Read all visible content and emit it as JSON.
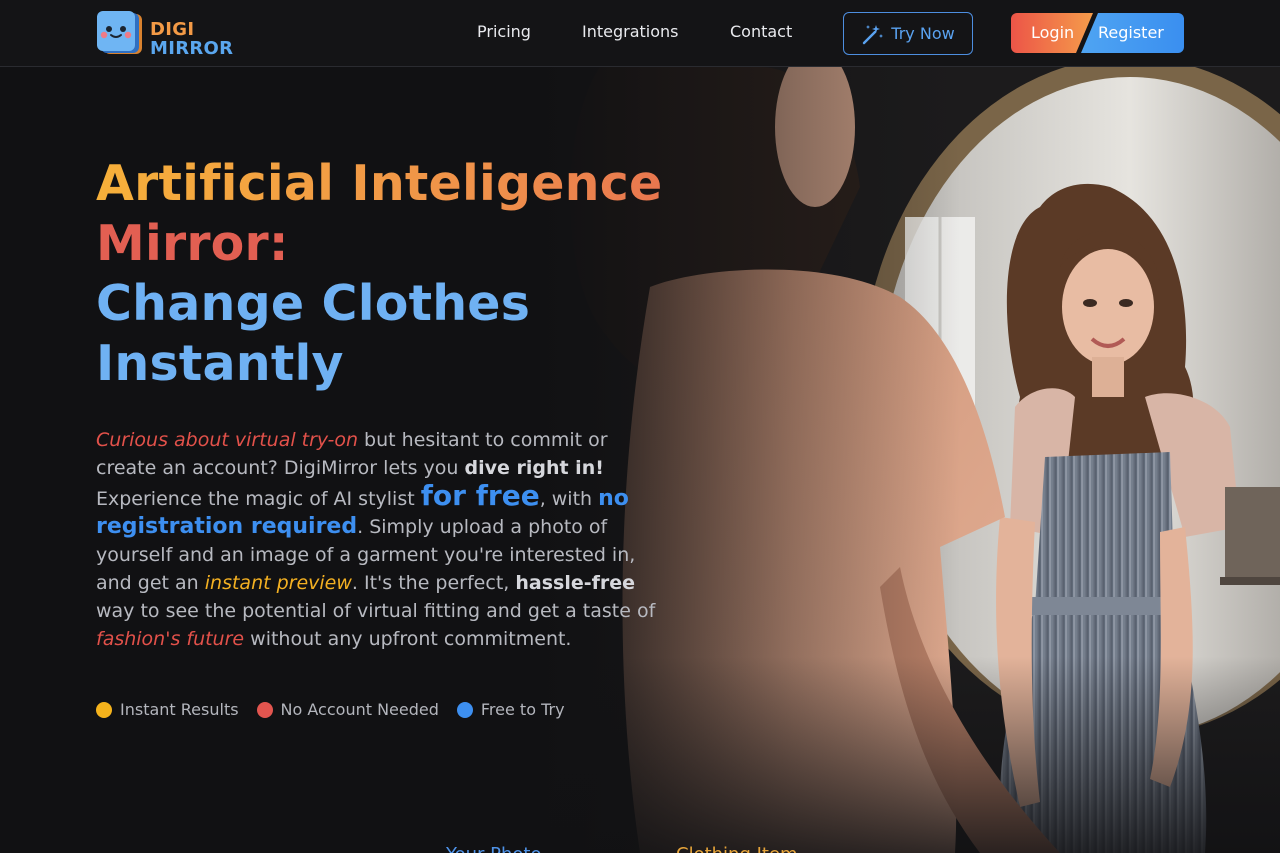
{
  "logo": {
    "line1": "DIGI",
    "line2": "MIRROR"
  },
  "nav": {
    "items": [
      {
        "label": "Pricing"
      },
      {
        "label": "Integrations"
      },
      {
        "label": "Contact"
      }
    ],
    "try_now": "Try Now",
    "login": "Login",
    "register": "Register"
  },
  "hero": {
    "title_line1": "Artificial Inteligence",
    "title_line2": "Mirror:",
    "title_line3": "Change Clothes",
    "title_line4": "Instantly",
    "description": {
      "s1": "Curious about virtual try-on",
      "s2": " but hesitant to commit or create an account? DigiMirror lets you ",
      "s3": "dive right in!",
      "s4": " Experience the magic of AI stylist ",
      "s5": "for free",
      "s6": ", with ",
      "s7": "no registration required",
      "s8": ". Simply upload a photo of yourself and an image of a garment you're interested in, and get an ",
      "s9": "instant preview",
      "s10": ". It's the perfect, ",
      "s11": "hassle-free",
      "s12": " way to see the potential of virtual fitting and get a taste of ",
      "s13": "fashion's future",
      "s14": " without any upfront commitment."
    },
    "features": [
      {
        "label": "Instant Results",
        "color": "#f5b31c"
      },
      {
        "label": "No Account Needed",
        "color": "#e2554f"
      },
      {
        "label": "Free to Try",
        "color": "#3d8ff0"
      }
    ]
  },
  "bottom": {
    "your_photo": "Your Photo",
    "clothing_item": "Clothing Item"
  },
  "colors": {
    "accent_blue": "#3d8ff0",
    "accent_orange": "#ef8f4b",
    "accent_red": "#e2554f",
    "background": "#111113"
  }
}
